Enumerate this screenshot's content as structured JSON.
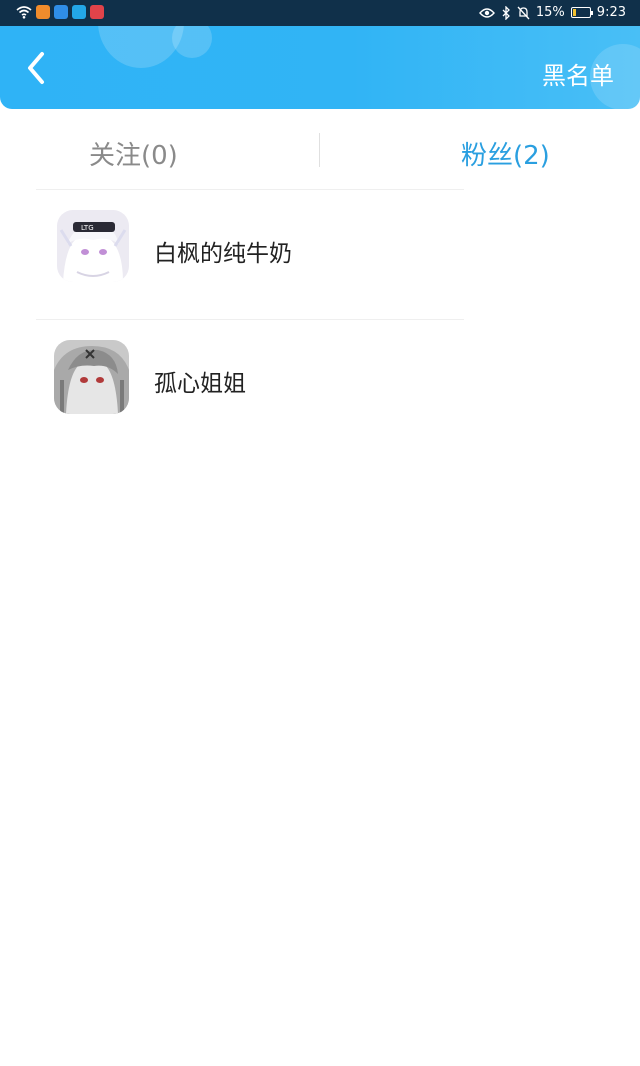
{
  "status_bar": {
    "battery": "15%",
    "time": "9:23",
    "battery_level": 0.15
  },
  "header": {
    "right_action": "黑名单",
    "back_icon": "chevron-left-icon"
  },
  "tabs": [
    {
      "label": "关注(0)",
      "active": false
    },
    {
      "label": "粉丝(2)",
      "active": true
    }
  ],
  "list": [
    {
      "name": "白枫的纯牛奶"
    },
    {
      "name": "孤心姐姐"
    }
  ],
  "colors": {
    "header": "#31b4f5",
    "active_tab": "#2a9fe0",
    "inactive_tab": "#8a8a8a"
  }
}
